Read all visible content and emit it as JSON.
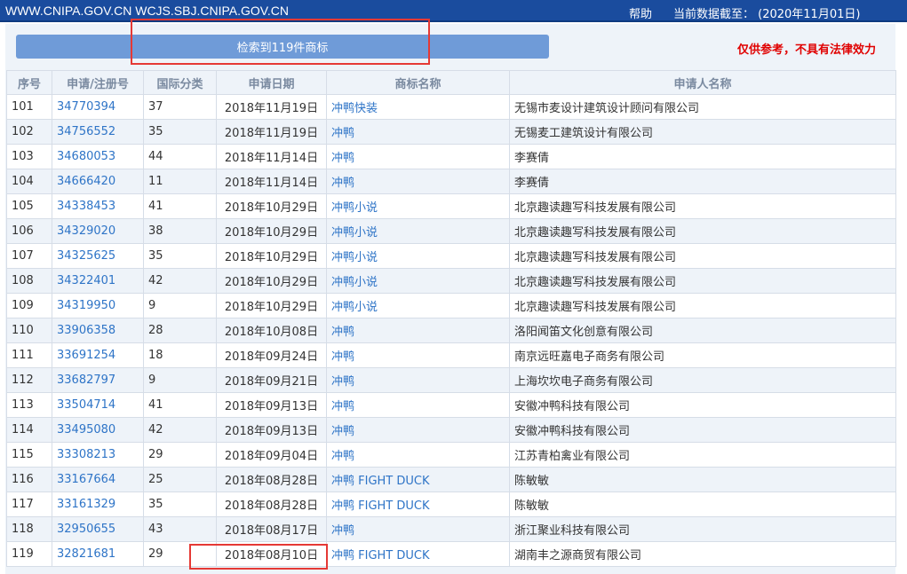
{
  "header": {
    "site_text": "WWW.CNIPA.GOV.CN WCJS.SBJ.CNIPA.GOV.CN",
    "help_label": "帮助",
    "data_as_of": "当前数据截至：  (2020年11月01日)"
  },
  "result_summary": "检索到119件商标",
  "disclaimer": "仅供参考，不具有法律效力",
  "table": {
    "columns": [
      "序号",
      "申请/注册号",
      "国际分类",
      "申请日期",
      "商标名称",
      "申请人名称"
    ],
    "rows": [
      {
        "no": "101",
        "reg": "34770394",
        "cls": "37",
        "date": "2018年11月19日",
        "mark": "冲鸭快装",
        "applicant": "无锡市麦设计建筑设计顾问有限公司"
      },
      {
        "no": "102",
        "reg": "34756552",
        "cls": "35",
        "date": "2018年11月19日",
        "mark": "冲鸭",
        "applicant": "无锡麦工建筑设计有限公司"
      },
      {
        "no": "103",
        "reg": "34680053",
        "cls": "44",
        "date": "2018年11月14日",
        "mark": "冲鸭",
        "applicant": "李赛倩"
      },
      {
        "no": "104",
        "reg": "34666420",
        "cls": "11",
        "date": "2018年11月14日",
        "mark": "冲鸭",
        "applicant": "李赛倩"
      },
      {
        "no": "105",
        "reg": "34338453",
        "cls": "41",
        "date": "2018年10月29日",
        "mark": "冲鸭小说",
        "applicant": "北京趣读趣写科技发展有限公司"
      },
      {
        "no": "106",
        "reg": "34329020",
        "cls": "38",
        "date": "2018年10月29日",
        "mark": "冲鸭小说",
        "applicant": "北京趣读趣写科技发展有限公司"
      },
      {
        "no": "107",
        "reg": "34325625",
        "cls": "35",
        "date": "2018年10月29日",
        "mark": "冲鸭小说",
        "applicant": "北京趣读趣写科技发展有限公司"
      },
      {
        "no": "108",
        "reg": "34322401",
        "cls": "42",
        "date": "2018年10月29日",
        "mark": "冲鸭小说",
        "applicant": "北京趣读趣写科技发展有限公司"
      },
      {
        "no": "109",
        "reg": "34319950",
        "cls": "9",
        "date": "2018年10月29日",
        "mark": "冲鸭小说",
        "applicant": "北京趣读趣写科技发展有限公司"
      },
      {
        "no": "110",
        "reg": "33906358",
        "cls": "28",
        "date": "2018年10月08日",
        "mark": "冲鸭",
        "applicant": "洛阳闻笛文化创意有限公司"
      },
      {
        "no": "111",
        "reg": "33691254",
        "cls": "18",
        "date": "2018年09月24日",
        "mark": "冲鸭",
        "applicant": "南京远旺嘉电子商务有限公司"
      },
      {
        "no": "112",
        "reg": "33682797",
        "cls": "9",
        "date": "2018年09月21日",
        "mark": "冲鸭",
        "applicant": "上海坎坎电子商务有限公司"
      },
      {
        "no": "113",
        "reg": "33504714",
        "cls": "41",
        "date": "2018年09月13日",
        "mark": "冲鸭",
        "applicant": "安徽冲鸭科技有限公司"
      },
      {
        "no": "114",
        "reg": "33495080",
        "cls": "42",
        "date": "2018年09月13日",
        "mark": "冲鸭",
        "applicant": "安徽冲鸭科技有限公司"
      },
      {
        "no": "115",
        "reg": "33308213",
        "cls": "29",
        "date": "2018年09月04日",
        "mark": "冲鸭",
        "applicant": "江苏青柏禽业有限公司"
      },
      {
        "no": "116",
        "reg": "33167664",
        "cls": "25",
        "date": "2018年08月28日",
        "mark": "冲鸭 FIGHT DUCK",
        "applicant": "陈敏敏"
      },
      {
        "no": "117",
        "reg": "33161329",
        "cls": "35",
        "date": "2018年08月28日",
        "mark": "冲鸭 FIGHT DUCK",
        "applicant": "陈敏敏"
      },
      {
        "no": "118",
        "reg": "32950655",
        "cls": "43",
        "date": "2018年08月17日",
        "mark": "冲鸭",
        "applicant": "浙江聚业科技有限公司"
      },
      {
        "no": "119",
        "reg": "32821681",
        "cls": "29",
        "date": "2018年08月10日",
        "mark": "冲鸭 FIGHT DUCK",
        "applicant": "湖南丰之源商贸有限公司"
      }
    ]
  },
  "colors": {
    "header_bg": "#1a4c9e",
    "result_bar": "#6f9bd8",
    "link": "#2e74c7",
    "disclaimer": "#e00000",
    "annotation": "#e53935"
  }
}
